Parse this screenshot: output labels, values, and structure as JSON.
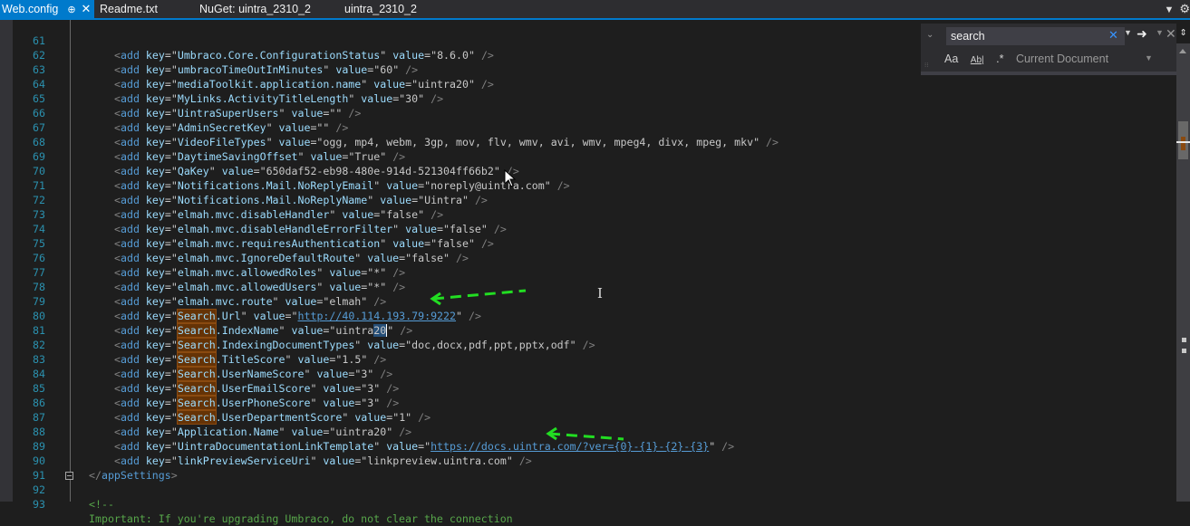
{
  "tabs": [
    {
      "label": "Web.config",
      "active": true,
      "pinned": true
    },
    {
      "label": "Readme.txt"
    },
    {
      "label": "NuGet: uintra_2310_2"
    },
    {
      "label": "uintra_2310_2"
    }
  ],
  "tab_icons": {
    "pin": "pin-icon",
    "close": "close-icon",
    "overflow": "chevron-down-icon",
    "settings": "gear-icon"
  },
  "find_widget": {
    "query": "search",
    "clear_glyph": "✕",
    "options": {
      "match_case": "Aa",
      "whole_word": "Ab|",
      "regex": ".*"
    },
    "scope": "Current Document"
  },
  "lines": [
    {
      "n": "61",
      "key": "Umbraco.Core.ConfigurationStatus",
      "value": "8.6.0"
    },
    {
      "n": "62",
      "key": "umbracoTimeOutInMinutes",
      "value": "60"
    },
    {
      "n": "63",
      "key": "mediaToolkit.application.name",
      "value": "uintra20"
    },
    {
      "n": "64",
      "key": "MyLinks.ActivityTitleLength",
      "value": "30"
    },
    {
      "n": "65",
      "key": "UintraSuperUsers",
      "value": ""
    },
    {
      "n": "66",
      "key": "AdminSecretKey",
      "value": ""
    },
    {
      "n": "67",
      "key": "VideoFileTypes",
      "value": "ogg, mp4, webm, 3gp, mov, flv, wmv, avi, wmv, mpeg4, divx, mpeg, mkv"
    },
    {
      "n": "68",
      "key": "DaytimeSavingOffset",
      "value": "True"
    },
    {
      "n": "69",
      "key": "QaKey",
      "value": "650daf52-eb98-480e-914d-521304ff66b2"
    },
    {
      "n": "70",
      "key": "Notifications.Mail.NoReplyEmail",
      "value": "noreply@uintra.com"
    },
    {
      "n": "71",
      "key": "Notifications.Mail.NoReplyName",
      "value": "Uintra"
    },
    {
      "n": "72",
      "key": "elmah.mvc.disableHandler",
      "value": "false"
    },
    {
      "n": "73",
      "key": "elmah.mvc.disableHandleErrorFilter",
      "value": "false"
    },
    {
      "n": "74",
      "key": "elmah.mvc.requiresAuthentication",
      "value": "false"
    },
    {
      "n": "75",
      "key": "elmah.mvc.IgnoreDefaultRoute",
      "value": "false"
    },
    {
      "n": "76",
      "key": "elmah.mvc.allowedRoles",
      "value": "*"
    },
    {
      "n": "77",
      "key": "elmah.mvc.allowedUsers",
      "value": "*"
    },
    {
      "n": "78",
      "key": "elmah.mvc.route",
      "value": "elmah"
    },
    {
      "n": "79",
      "key_hl": "Search",
      "key": ".Url",
      "value": "http://40.114.193.79:9222",
      "url": true
    },
    {
      "n": "80",
      "key_hl": "Search",
      "key": ".IndexName",
      "value": "uintra",
      "value_sel": "20"
    },
    {
      "n": "81",
      "key_hl": "Search",
      "key": ".IndexingDocumentTypes",
      "value": "doc,docx,pdf,ppt,pptx,odf"
    },
    {
      "n": "82",
      "key_hl": "Search",
      "key": ".TitleScore",
      "value": "1.5"
    },
    {
      "n": "83",
      "key_hl": "Search",
      "key": ".UserNameScore",
      "value": "3"
    },
    {
      "n": "84",
      "key_hl": "Search",
      "key": ".UserEmailScore",
      "value": "3"
    },
    {
      "n": "85",
      "key_hl": "Search",
      "key": ".UserPhoneScore",
      "value": "3"
    },
    {
      "n": "86",
      "key_hl": "Search",
      "key": ".UserDepartmentScore",
      "value": "1"
    },
    {
      "n": "87",
      "key": "Application.Name",
      "value": "uintra20"
    },
    {
      "n": "88",
      "key": "UintraDocumentationLinkTemplate",
      "value": "https://docs.uintra.com/?ver={0}-{1}-{2}-{3}",
      "url": true
    },
    {
      "n": "89",
      "key": "linkPreviewServiceUri",
      "value": "linkpreview.uintra.com"
    }
  ],
  "tail_lines": [
    {
      "n": "90",
      "type": "close",
      "text": "appSettings"
    },
    {
      "n": "91",
      "type": "blank",
      "text": ""
    },
    {
      "n": "92",
      "type": "comment",
      "text": "<!--"
    },
    {
      "n": "93",
      "type": "comment",
      "text": "Important: If you're upgrading Umbraco, do not clear the connection"
    }
  ],
  "syntax": {
    "element": "add",
    "attr_key": "key",
    "attr_value": "value"
  },
  "annotations": [
    {
      "type": "dashed-arrow",
      "color": "#22dd22",
      "points_to_line": "80"
    },
    {
      "type": "dashed-arrow",
      "color": "#22dd22",
      "points_to_line": "89"
    }
  ],
  "colors": {
    "accent": "#007acc",
    "find_highlight": "#653306",
    "selection": "#264f78",
    "line_numbers": "#2b91af"
  }
}
